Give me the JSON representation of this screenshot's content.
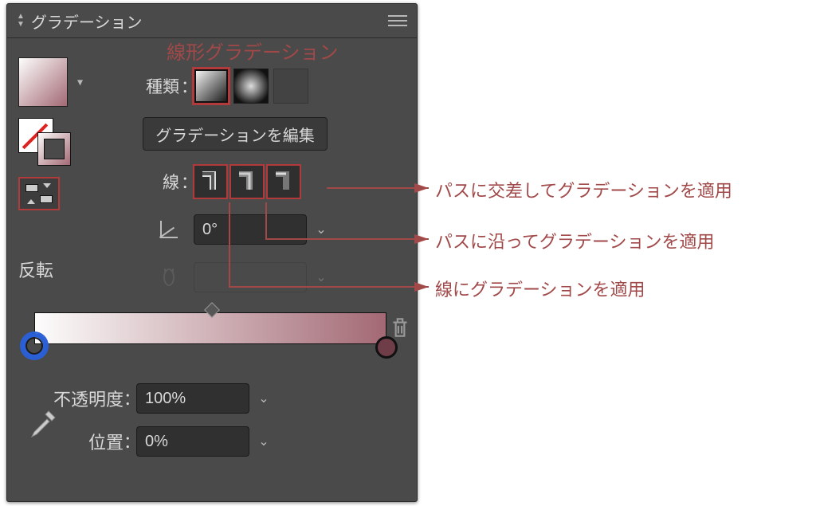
{
  "panel": {
    "title": "グラデーション",
    "subtitle": "線形グラデーション",
    "type_label": "種類",
    "edit_button": "グラデーションを編集",
    "stroke_label": "線",
    "angle_value": "0°",
    "opacity_label": "不透明度",
    "opacity_value": "100%",
    "position_label": "位置",
    "position_value": "0%",
    "reverse_label": "反転",
    "colon": "：",
    "gradient": {
      "start_color": "#fdfdfc",
      "end_color": "#a36974",
      "midpoint_percent": 50
    },
    "type_options": [
      "linear",
      "radial",
      "freeform"
    ],
    "type_selected": "linear",
    "stroke_mode_options": [
      "within",
      "along",
      "across"
    ]
  },
  "annotations": {
    "across": "パスに交差してグラデーションを適用",
    "along": "パスに沿ってグラデーションを適用",
    "within": "線にグラデーションを適用"
  },
  "icons": {
    "collapse": "collapse-icon",
    "menu": "menu-icon",
    "trash": "trash-icon",
    "eyedropper": "eyedropper-icon",
    "angle": "angle-icon",
    "ratio": "ratio-icon",
    "chevron": "chevron-down-icon"
  }
}
